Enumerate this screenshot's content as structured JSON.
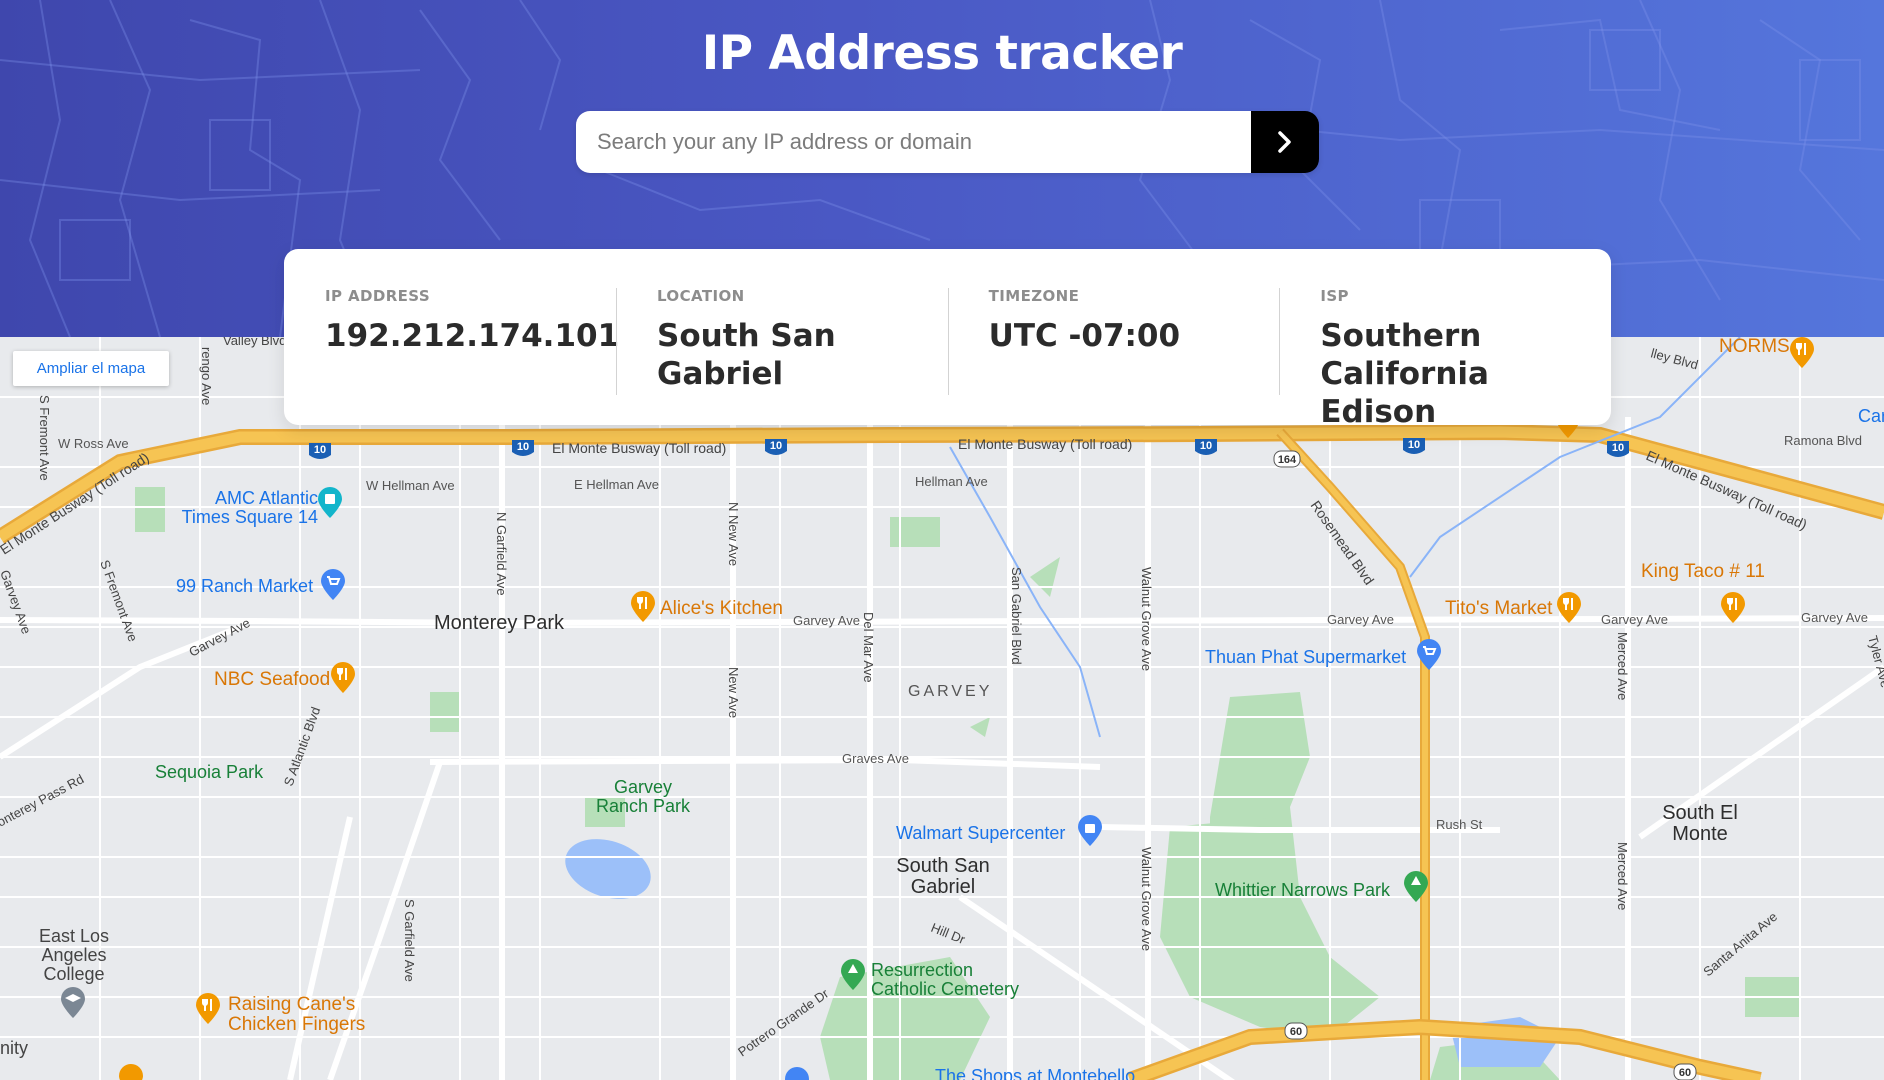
{
  "header": {
    "title": "IP Address tracker",
    "search": {
      "placeholder": "Search your any IP address or domain",
      "value": "",
      "button_icon": "chevron-right-icon"
    }
  },
  "info": {
    "ip": {
      "label": "IP ADDRESS",
      "value": "192.212.174.101"
    },
    "location": {
      "label": "LOCATION",
      "value": "South San Gabriel"
    },
    "timezone": {
      "label": "TIMEZONE",
      "value": "UTC -07:00"
    },
    "isp": {
      "label": "ISP",
      "value": "Southern California Edison"
    }
  },
  "map": {
    "expand_label": "Ampliar el mapa",
    "cities": {
      "monterey_park": "Monterey Park",
      "south_san_gabriel": "South San Gabriel",
      "south_el_monte": "South El Monte",
      "garvey": "GARVEY",
      "east_la_college": "East Los Angeles College",
      "unity_fragment": "nity"
    },
    "pois": {
      "amc": "AMC Atlantic Times Square 14",
      "ranch99": "99 Ranch Market",
      "alices": "Alice's Kitchen",
      "nbc": "NBC Seafood",
      "sequoia": "Sequoia Park",
      "garvey_ranch": "Garvey Ranch Park",
      "walmart": "Walmart Supercenter",
      "whittier": "Whittier Narrows Park",
      "resurrection": "Resurrection Catholic Cemetery",
      "raising_canes": "Raising Cane's Chicken Fingers",
      "king_taco": "King Taco # 11",
      "titos": "Tito's Market",
      "thuan_phat": "Thuan Phat Supermarket",
      "norms": "NORMS",
      "shops": "The Shops at Montebello",
      "car_fragment": "Car"
    },
    "streets": {
      "busway_left": "El Monte Busway (Toll road)",
      "busway_mid": "El Monte Busway (Toll road)",
      "busway_mid2": "El Monte Busway (Toll road)",
      "busway_right": "El Monte Busway (Toll road)",
      "w_ross": "W Ross Ave",
      "w_hellman": "W Hellman Ave",
      "e_hellman": "E Hellman Ave",
      "hellman": "Hellman Ave",
      "garvey1": "Garvey Ave",
      "garvey2": "Garvey Ave",
      "garvey3": "Garvey Ave",
      "garvey4": "Garvey Ave",
      "garvey5": "Garvey Ave",
      "graves": "Graves Ave",
      "rush": "Rush St",
      "ramona": "Ramona Blvd",
      "n_garfield": "N Garfield Ave",
      "s_garfield": "S Garfield Ave",
      "n_new": "N New Ave",
      "new_ave": "New Ave",
      "del_mar": "Del Mar Ave",
      "san_gabriel": "San Gabriel Blvd",
      "walnut1": "Walnut Grove Ave",
      "walnut2": "Walnut Grove Ave",
      "rosemead": "Rosemead Blvd",
      "merced1": "Merced Ave",
      "merced2": "Merced Ave",
      "s_atlantic": "S Atlantic Blvd",
      "s_fremont1": "S Fremont Ave",
      "s_fremont2": "S Fremont Ave",
      "garvey_curve": "Garvey Ave",
      "monterey_pass": "onterey Pass Rd",
      "hill_dr": "Hill Dr",
      "potrero": "Potrero Grande Dr",
      "santa_anita": "Santa Anita Ave",
      "tyler": "Tyler Ave",
      "valley": "Valley Blvd",
      "valley_right": "lley Blvd",
      "arengo": "rengo Ave",
      "garvey_left": "Garvey Ave"
    },
    "shields": {
      "i10": "10",
      "r164": "164",
      "r60": "60"
    },
    "colors": {
      "land": "#e8eaed",
      "road": "#ffffff",
      "highway": "#f6c453",
      "highway_edge": "#e8a93a",
      "park": "#b7dfb9",
      "water": "#9cc0f9",
      "accent": "#1a73e8"
    }
  }
}
